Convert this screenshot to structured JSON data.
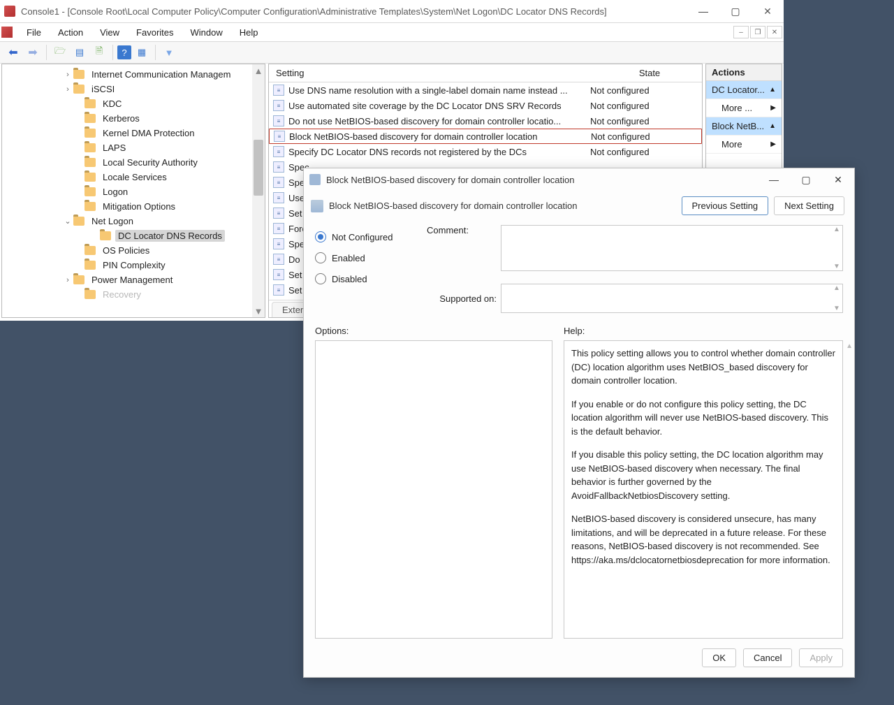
{
  "window": {
    "title": "Console1 - [Console Root\\Local Computer Policy\\Computer Configuration\\Administrative Templates\\System\\Net Logon\\DC Locator DNS Records]"
  },
  "menu": [
    "File",
    "Action",
    "View",
    "Favorites",
    "Window",
    "Help"
  ],
  "tree": {
    "items": [
      {
        "label": "Internet Communication Managem",
        "indent": 100,
        "exp": ">"
      },
      {
        "label": "iSCSI",
        "indent": 100,
        "exp": ">"
      },
      {
        "label": "KDC",
        "indent": 116,
        "exp": ""
      },
      {
        "label": "Kerberos",
        "indent": 116,
        "exp": ""
      },
      {
        "label": "Kernel DMA Protection",
        "indent": 116,
        "exp": ""
      },
      {
        "label": "LAPS",
        "indent": 116,
        "exp": ""
      },
      {
        "label": "Local Security Authority",
        "indent": 116,
        "exp": ""
      },
      {
        "label": "Locale Services",
        "indent": 116,
        "exp": ""
      },
      {
        "label": "Logon",
        "indent": 116,
        "exp": ""
      },
      {
        "label": "Mitigation Options",
        "indent": 116,
        "exp": ""
      },
      {
        "label": "Net Logon",
        "indent": 100,
        "exp": "v"
      },
      {
        "label": "DC Locator DNS Records",
        "indent": 138,
        "exp": "",
        "selected": true
      },
      {
        "label": "OS Policies",
        "indent": 116,
        "exp": ""
      },
      {
        "label": "PIN Complexity",
        "indent": 116,
        "exp": ""
      },
      {
        "label": "Power Management",
        "indent": 100,
        "exp": ">"
      },
      {
        "label": "Recovery",
        "indent": 116,
        "exp": "",
        "faded": true
      }
    ]
  },
  "list": {
    "columns": {
      "setting": "Setting",
      "state": "State"
    },
    "rows": [
      {
        "name": "Use DNS name resolution with a single-label domain name instead ...",
        "state": "Not configured"
      },
      {
        "name": "Use automated site coverage by the DC Locator DNS SRV Records",
        "state": "Not configured"
      },
      {
        "name": "Do not use NetBIOS-based discovery for domain controller locatio...",
        "state": "Not configured"
      },
      {
        "name": "Block NetBIOS-based discovery for domain controller location",
        "state": "Not configured",
        "highlight": true
      },
      {
        "name": "Specify DC Locator DNS records not registered by the DCs",
        "state": "Not configured"
      },
      {
        "name": "Spec",
        "state": ""
      },
      {
        "name": "Spec",
        "state": ""
      },
      {
        "name": "Use",
        "state": ""
      },
      {
        "name": "Set T",
        "state": ""
      },
      {
        "name": "Forc",
        "state": ""
      },
      {
        "name": "Spec",
        "state": ""
      },
      {
        "name": "Do n",
        "state": ""
      },
      {
        "name": "Set P",
        "state": ""
      },
      {
        "name": "Set V",
        "state": ""
      }
    ],
    "tab": "Extende"
  },
  "actions": {
    "title": "Actions",
    "rows": [
      {
        "label": "DC Locator...",
        "hi": true,
        "arrow": "up"
      },
      {
        "label": "More ...",
        "hi": false,
        "arrow": "right",
        "sub": true
      },
      {
        "label": "Block NetB...",
        "hi": true,
        "arrow": "up"
      },
      {
        "label": "More",
        "hi": false,
        "arrow": "right",
        "sub": true
      }
    ]
  },
  "dialog": {
    "title": "Block NetBIOS-based discovery for domain controller location",
    "policy_name": "Block NetBIOS-based discovery for domain controller location",
    "prev": "Previous Setting",
    "next": "Next Setting",
    "states": {
      "not_configured": "Not Configured",
      "enabled": "Enabled",
      "disabled": "Disabled"
    },
    "labels": {
      "comment": "Comment:",
      "supported": "Supported on:",
      "options": "Options:",
      "help": "Help:"
    },
    "help": "This policy setting allows you to control whether domain controller (DC) location algorithm uses NetBIOS_based discovery for domain controller location.\n\nIf you enable or do not configure this policy setting, the DC location algorithm will never use NetBIOS-based discovery. This is the default behavior.\n\nIf you disable this policy setting, the DC location algorithm may use NetBIOS-based discovery when necessary. The final behavior is further governed by the AvoidFallbackNetbiosDiscovery setting.\n\nNetBIOS-based discovery is considered unsecure, has many limitations, and will be deprecated in a future release. For these reasons, NetBIOS-based discovery is not recommended. See https://aka.ms/dclocatornetbiosdeprecation for more information.",
    "buttons": {
      "ok": "OK",
      "cancel": "Cancel",
      "apply": "Apply"
    }
  }
}
